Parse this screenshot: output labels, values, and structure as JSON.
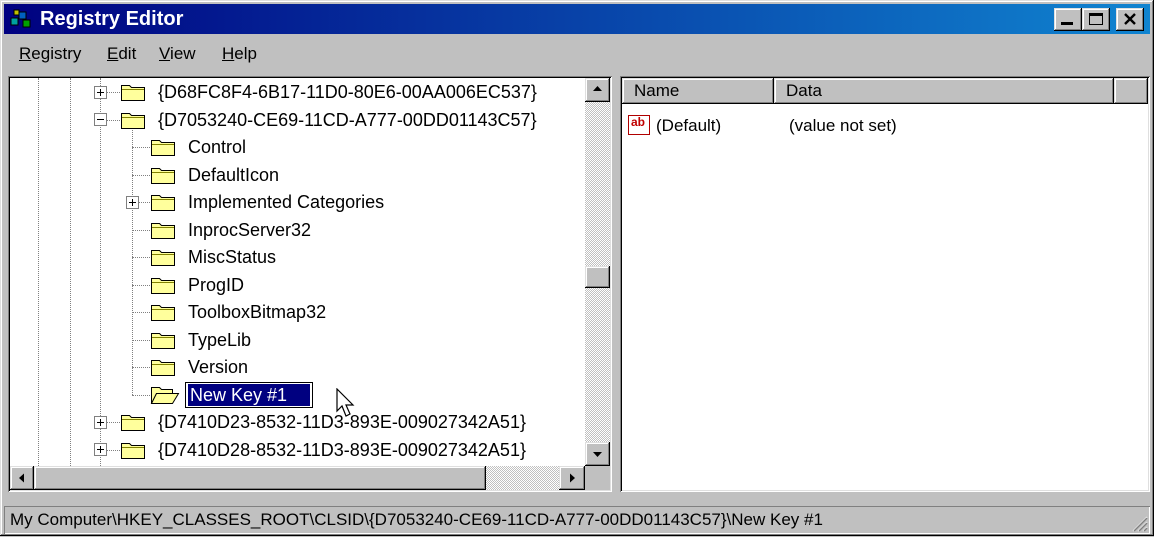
{
  "window": {
    "title": "Registry Editor",
    "icon": "registry-editor-icon",
    "caption_buttons": [
      "minimize-icon",
      "maximize-icon",
      "close-icon"
    ]
  },
  "menu": [
    {
      "label": "Registry"
    },
    {
      "label": "Edit"
    },
    {
      "label": "View"
    },
    {
      "label": "Help"
    }
  ],
  "tree": {
    "items": [
      {
        "label": "{D68FC8F4-6B17-11D0-80E6-00AA006EC537}",
        "level": 0,
        "expander": "plus"
      },
      {
        "label": "{D7053240-CE69-11CD-A777-00DD01143C57}",
        "level": 0,
        "expander": "minus"
      },
      {
        "label": "Control",
        "level": 1,
        "expander": null
      },
      {
        "label": "DefaultIcon",
        "level": 1,
        "expander": null
      },
      {
        "label": "Implemented Categories",
        "level": 1,
        "expander": "plus"
      },
      {
        "label": "InprocServer32",
        "level": 1,
        "expander": null
      },
      {
        "label": "MiscStatus",
        "level": 1,
        "expander": null
      },
      {
        "label": "ProgID",
        "level": 1,
        "expander": null
      },
      {
        "label": "ToolboxBitmap32",
        "level": 1,
        "expander": null
      },
      {
        "label": "TypeLib",
        "level": 1,
        "expander": null
      },
      {
        "label": "Version",
        "level": 1,
        "expander": null
      },
      {
        "label": "New Key #1",
        "level": 1,
        "expander": null,
        "editing": true
      },
      {
        "label": "{D7410D23-8532-11D3-893E-009027342A51}",
        "level": 0,
        "expander": "plus"
      },
      {
        "label": "{D7410D28-8532-11D3-893E-009027342A51}",
        "level": 0,
        "expander": "plus"
      }
    ]
  },
  "values": {
    "columns": [
      {
        "label": "Name"
      },
      {
        "label": "Data"
      }
    ],
    "rows": [
      {
        "icon": "string-value-icon",
        "icon_text": "ab",
        "name": "(Default)",
        "data": "(value not set)"
      }
    ]
  },
  "status_bar": {
    "path": "My Computer\\HKEY_CLASSES_ROOT\\CLSID\\{D7053240-CE69-11CD-A777-00DD01143C57}\\New Key #1"
  },
  "colors": {
    "title_start": "#000080",
    "title_end": "#1084d0",
    "selection": "#000080",
    "face": "#c0c0c0",
    "folder": "#ffff9c"
  }
}
